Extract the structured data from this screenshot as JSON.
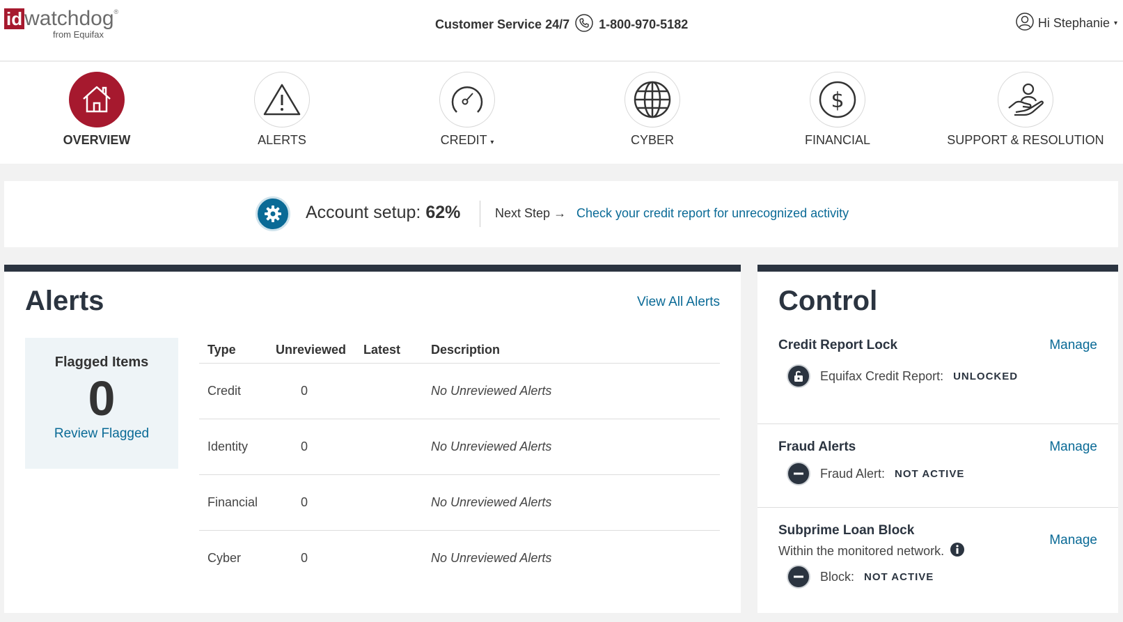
{
  "header": {
    "logo_id": "id",
    "logo_name": "watchdog",
    "logo_reg": "®",
    "logo_sub": "from Equifax",
    "customer_service_label": "Customer Service 24/7",
    "phone": "1-800-970-5182",
    "user_greeting": "Hi Stephanie",
    "user_caret": "▾"
  },
  "nav": {
    "items": [
      {
        "label": "OVERVIEW",
        "icon": "home-icon",
        "active": true
      },
      {
        "label": "ALERTS",
        "icon": "warning-icon",
        "active": false
      },
      {
        "label": "CREDIT",
        "icon": "gauge-icon",
        "active": false,
        "caret": "▾"
      },
      {
        "label": "CYBER",
        "icon": "globe-icon",
        "active": false
      },
      {
        "label": "FINANCIAL",
        "icon": "dollar-icon",
        "active": false
      },
      {
        "label": "SUPPORT & RESOLUTION",
        "icon": "support-hand-icon",
        "active": false
      }
    ]
  },
  "setup": {
    "label": "Account setup:",
    "percent": "62%",
    "next_step_label": "Next Step",
    "arrow": "→",
    "next_step_link": "Check your credit report for unrecognized activity"
  },
  "alerts": {
    "title": "Alerts",
    "view_all": "View All Alerts",
    "flagged": {
      "title": "Flagged Items",
      "count": "0",
      "link": "Review Flagged"
    },
    "columns": [
      "Type",
      "Unreviewed",
      "Latest",
      "Description"
    ],
    "rows": [
      {
        "type": "Credit",
        "unreviewed": "0",
        "latest": "",
        "description": "No Unreviewed Alerts"
      },
      {
        "type": "Identity",
        "unreviewed": "0",
        "latest": "",
        "description": "No Unreviewed Alerts"
      },
      {
        "type": "Financial",
        "unreviewed": "0",
        "latest": "",
        "description": "No Unreviewed Alerts"
      },
      {
        "type": "Cyber",
        "unreviewed": "0",
        "latest": "",
        "description": "No Unreviewed Alerts"
      }
    ]
  },
  "control": {
    "title": "Control",
    "sections": [
      {
        "title": "Credit Report Lock",
        "manage": "Manage",
        "status_label": "Equifax Credit Report:",
        "status_value": "UNLOCKED",
        "icon": "unlock-icon"
      },
      {
        "title": "Fraud Alerts",
        "manage": "Manage",
        "status_label": "Fraud Alert:",
        "status_value": "NOT ACTIVE",
        "icon": "minus-icon"
      },
      {
        "title": "Subprime Loan Block",
        "subtitle": "Within the monitored network.",
        "manage": "Manage",
        "status_label": "Block:",
        "status_value": "NOT ACTIVE",
        "icon": "minus-icon"
      }
    ]
  },
  "colors": {
    "brand": "#a6192e",
    "link": "#0a6a96",
    "dark": "#2b3440"
  }
}
